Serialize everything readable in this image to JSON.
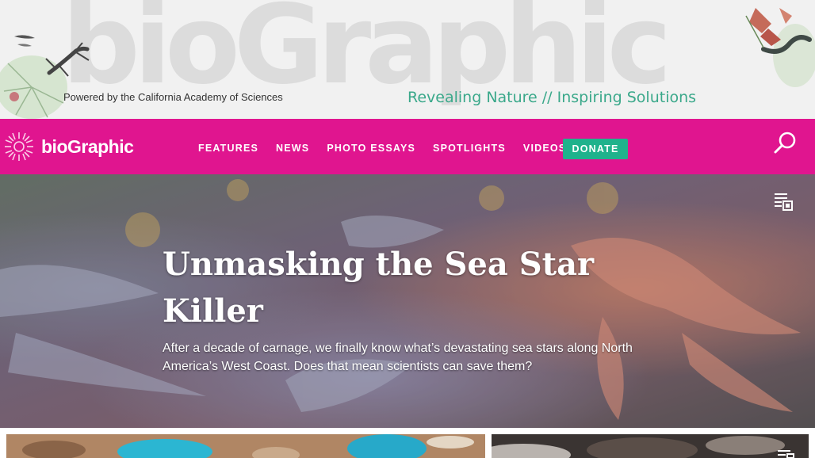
{
  "banner": {
    "wordmark": "bioGraphic",
    "powered_by": "Powered by the California Academy of Sciences",
    "tagline": "Revealing Nature // Inspiring Solutions"
  },
  "nav": {
    "logo_text": "bioGraphic",
    "links": [
      "FEATURES",
      "NEWS",
      "PHOTO ESSAYS",
      "SPOTLIGHTS",
      "VIDEOS"
    ],
    "donate": "DONATE",
    "search_icon": "search-icon"
  },
  "hero": {
    "title": "Unmasking the Sea Star Killer",
    "description": "After a decade of carnage, we finally know what’s devastating sea stars along North America’s West Coast. Does that mean scientists can save them?",
    "icon": "article-icon"
  },
  "colors": {
    "nav_bg": "#e0158f",
    "donate_bg": "#1fb28c",
    "tagline": "#3aa88a",
    "banner_bg": "#f1f1f1"
  }
}
